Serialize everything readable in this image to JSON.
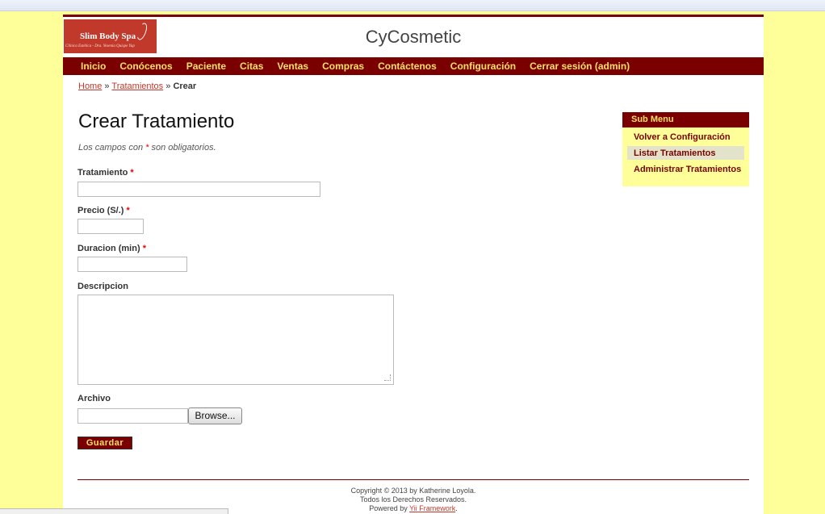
{
  "header": {
    "logo_name": "Slim Body Spa",
    "logo_tagline": "Clínica Estética - Dra. Yesenia Quispe Yup",
    "site_title": "CyCosmetic"
  },
  "mainmenu": {
    "items": [
      "Inicio",
      "Conócenos",
      "Paciente",
      "Citas",
      "Ventas",
      "Compras",
      "Contáctenos",
      "Configuración",
      "Cerrar sesión (admin)"
    ]
  },
  "breadcrumbs": {
    "home": "Home",
    "sep1": "»",
    "tratamientos": "Tratamientos",
    "sep2": "»",
    "current": "Crear"
  },
  "form": {
    "title": "Crear Tratamiento",
    "note_before": "Los campos con",
    "note_star": "*",
    "note_after": "son obligatorios.",
    "required_mark": "*",
    "tratamiento_label": "Tratamiento",
    "tratamiento_value": "",
    "precio_label": "Precio (S/.)",
    "precio_value": "",
    "duracion_label": "Duracion (min)",
    "duracion_value": "",
    "descripcion_label": "Descripcion",
    "descripcion_value": "",
    "archivo_label": "Archivo",
    "archivo_value": "",
    "browse_label": "Browse...",
    "save_label": "Guardar"
  },
  "sidebar": {
    "title": "Sub Menu",
    "items": [
      "Volver a Configuración",
      "Listar Tratamientos",
      "Administrar Tratamientos"
    ]
  },
  "footer": {
    "copyright": "Copyright © 2013 by Katherine Loyola.",
    "rights": "Todos los Derechos Reservados.",
    "powered_prefix": "Powered by",
    "framework_link": "Yii Framework",
    "powered_suffix": "."
  },
  "colors": {
    "background": "#ffff99",
    "menu_bar": "#7a0000",
    "menu_text": "#ffe066",
    "link": "#c0392b",
    "required": "#e00000"
  }
}
